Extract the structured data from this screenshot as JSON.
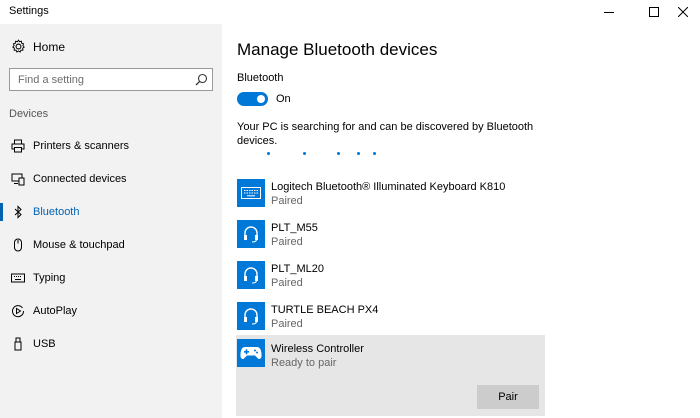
{
  "window": {
    "title": "Settings"
  },
  "sidebar": {
    "home_label": "Home",
    "search_placeholder": "Find a setting",
    "section_label": "Devices",
    "items": [
      {
        "label": "Printers & scanners",
        "icon": "printer-icon"
      },
      {
        "label": "Connected devices",
        "icon": "connected-devices-icon"
      },
      {
        "label": "Bluetooth",
        "icon": "bluetooth-icon",
        "active": true
      },
      {
        "label": "Mouse & touchpad",
        "icon": "mouse-icon"
      },
      {
        "label": "Typing",
        "icon": "keyboard-icon"
      },
      {
        "label": "AutoPlay",
        "icon": "autoplay-icon"
      },
      {
        "label": "USB",
        "icon": "usb-icon"
      }
    ]
  },
  "main": {
    "title": "Manage Bluetooth devices",
    "bluetooth_label": "Bluetooth",
    "toggle_state": "On",
    "searching_text": "Your PC is searching for and can be discovered by Bluetooth devices.",
    "devices": [
      {
        "name": "Logitech Bluetooth® Illuminated Keyboard K810",
        "status": "Paired",
        "icon": "keyboard-icon"
      },
      {
        "name": "PLT_M55",
        "status": "Paired",
        "icon": "headset-icon"
      },
      {
        "name": "PLT_ML20",
        "status": "Paired",
        "icon": "headset-icon"
      },
      {
        "name": "TURTLE BEACH PX4",
        "status": "Paired",
        "icon": "headset-icon"
      },
      {
        "name": "Wireless Controller",
        "status": "Ready to pair",
        "icon": "gamepad-icon",
        "selected": true
      }
    ],
    "pair_label": "Pair"
  },
  "colors": {
    "accent": "#0078d7",
    "accent_text": "#0063b1",
    "sidebar_bg": "#f2f2f2",
    "selected_bg": "#e6e6e6"
  }
}
